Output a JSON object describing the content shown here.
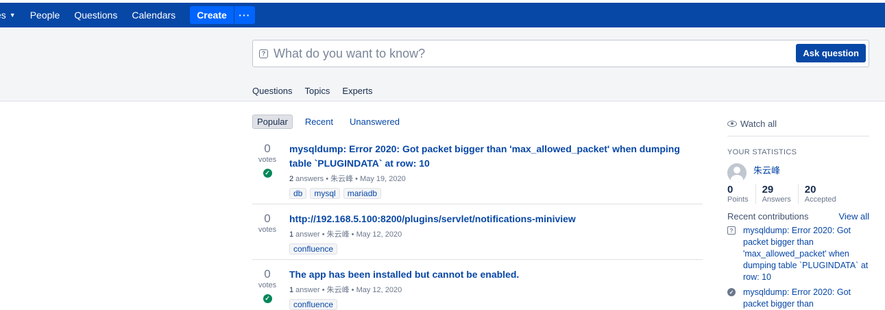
{
  "topbar": {
    "nav_spaces": "es",
    "nav_people": "People",
    "nav_questions": "Questions",
    "nav_calendars": "Calendars",
    "create_label": "Create",
    "more_label": "···"
  },
  "search": {
    "placeholder": "What do you want to know?",
    "ask_label": "Ask question"
  },
  "subnav": [
    "Questions",
    "Topics",
    "Experts"
  ],
  "filters": [
    "Popular",
    "Recent",
    "Unanswered"
  ],
  "questions": [
    {
      "votes": "0",
      "votes_label": "votes",
      "title": "mysqldump: Error 2020: Got packet bigger than 'max_allowed_packet' when dumping table `PLUGINDATA` at row: 10",
      "answers_count": "2",
      "answers_label": " answers",
      "author": "朱云峰",
      "date": "May 19, 2020",
      "tags": [
        "db",
        "mysql",
        "mariadb"
      ]
    },
    {
      "votes": "0",
      "votes_label": "votes",
      "title": "http://192.168.5.100:8200/plugins/servlet/notifications-miniview",
      "answers_count": "1",
      "answers_label": " answer",
      "author": "朱云峰",
      "date": "May 12, 2020",
      "tags": [
        "confluence"
      ]
    },
    {
      "votes": "0",
      "votes_label": "votes",
      "title": "The app has been installed but cannot be enabled.",
      "answers_count": "1",
      "answers_label": " answer",
      "author": "朱云峰",
      "date": "May 12, 2020",
      "tags": [
        "confluence"
      ]
    }
  ],
  "sidebar": {
    "watch_all": "Watch all",
    "stats_heading": "YOUR STATISTICS",
    "username": "朱云峰",
    "points": "0",
    "points_label": "Points",
    "answers": "29",
    "answers_label": "Answers",
    "accepted": "20",
    "accepted_label": "Accepted",
    "recent_heading": "Recent contributions",
    "view_all": "View all",
    "contributions": [
      "mysqldump: Error 2020: Got packet bigger than 'max_allowed_packet' when dumping table `PLUGINDATA` at row: 10",
      "mysqldump: Error 2020: Got packet bigger than"
    ]
  },
  "colors": {
    "topbar": "#0747a6",
    "create": "#0065ff",
    "link": "#0747a6",
    "accepted": "#00875a"
  }
}
